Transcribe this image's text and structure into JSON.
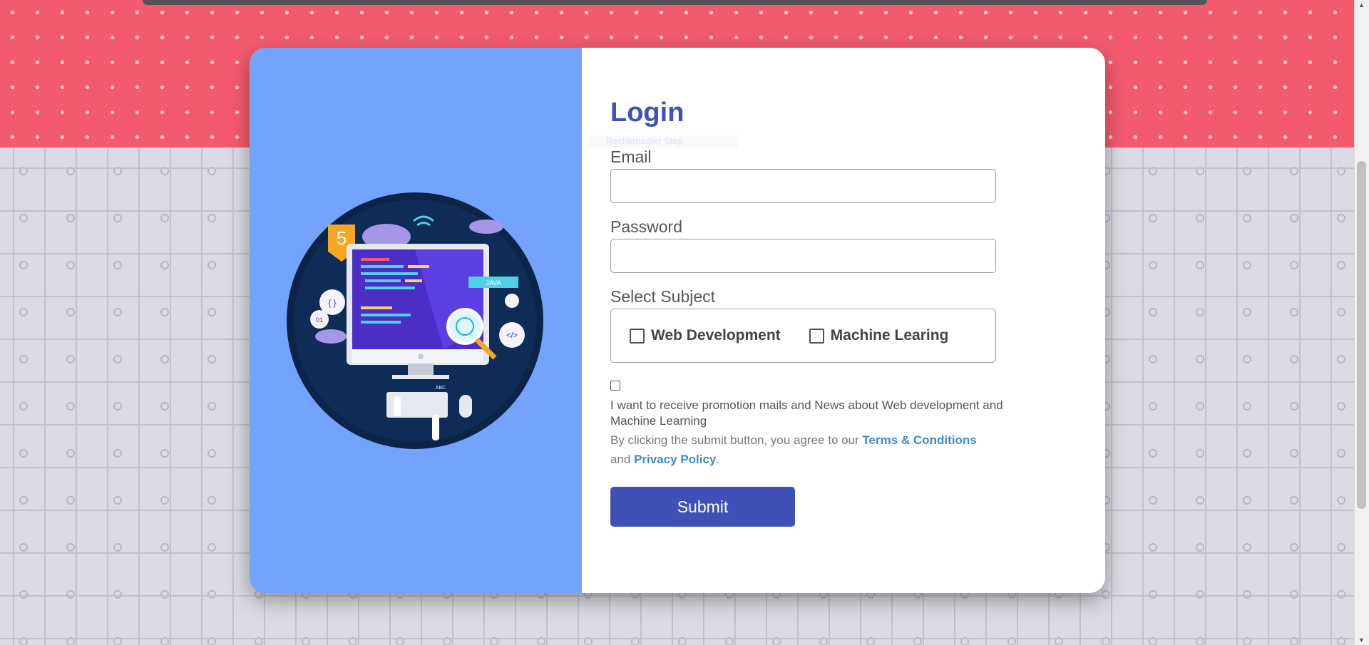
{
  "form": {
    "title": "Login",
    "ghost_text": "Rechtenadler Step",
    "email_label": "Email",
    "email_value": "",
    "password_label": "Password",
    "password_value": "",
    "subject_label": "Select Subject",
    "subjects": [
      "Web Development",
      "Machine Learing"
    ],
    "promo_text": "I want to receive promotion mails and News about Web development and Machine Learning",
    "terms_prefix": "By clicking the submit button, you agree to our ",
    "terms_link": "Terms & Conditions",
    "terms_mid": "and ",
    "privacy_link": "Privacy Policy",
    "terms_suffix": ".",
    "submit_label": "Submit"
  },
  "illustration": {
    "badge": "5",
    "tag_java": "JAVA",
    "bubble_braces": "{ }",
    "bubble_code": "</>",
    "bubble_binary": "01",
    "keyboard_label": "ABC"
  },
  "colors": {
    "accent": "#3f51b5",
    "panel_blue": "#74a3fd",
    "top_band": "#f45a6e",
    "link": "#3b8bc6"
  }
}
